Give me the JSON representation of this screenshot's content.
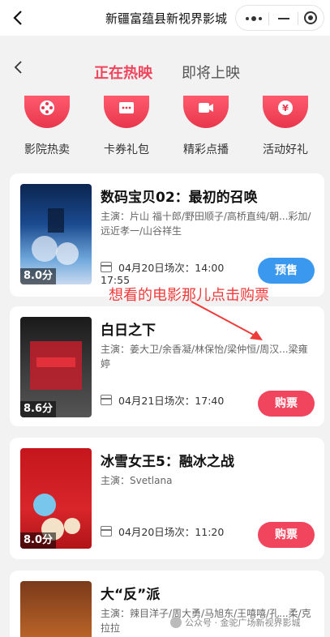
{
  "window": {
    "title": "新疆富蕴县新视界影城"
  },
  "tabs": [
    {
      "label": "正在热映",
      "active": true
    },
    {
      "label": "即将上映",
      "active": false
    }
  ],
  "categories": [
    {
      "label": "影院热卖",
      "icon": "film-reel-icon"
    },
    {
      "label": "卡券礼包",
      "icon": "coupon-icon"
    },
    {
      "label": "精彩点播",
      "icon": "video-play-icon"
    },
    {
      "label": "活动好礼",
      "icon": "yuan-coin-icon"
    }
  ],
  "movies": [
    {
      "title": "数码宝贝02：最初的召唤",
      "cast": "主演：片山 福十郎/野田顺子/高桥直纯/朝...彩加/远近孝一/山谷祥生",
      "rating": "8.0分",
      "show": "04月20日场次：14:00",
      "show_extra": "17:55",
      "button": "预售"
    },
    {
      "title": "白日之下",
      "cast": "主演：姜大卫/余香凝/林保怡/梁仲恒/周汉...梁雍婷",
      "rating": "8.6分",
      "show": "04月21日场次：17:40",
      "button": "购票"
    },
    {
      "title": "冰雪女王5：融冰之战",
      "cast": "主演：Svetlana",
      "rating": "8.0分",
      "show": "04月20日场次：11:20",
      "button": "购票"
    },
    {
      "title": "大“反”派",
      "cast": "主演：辣目洋子/周大勇/马旭东/王嘻嘻/孔...柔/克拉拉"
    }
  ],
  "annotation": "想看的电影那儿点击购票",
  "watermark": "公众号 · 金驼广场新视界影城",
  "colors": {
    "accent": "#f0455c",
    "presale": "#3a98ef"
  }
}
